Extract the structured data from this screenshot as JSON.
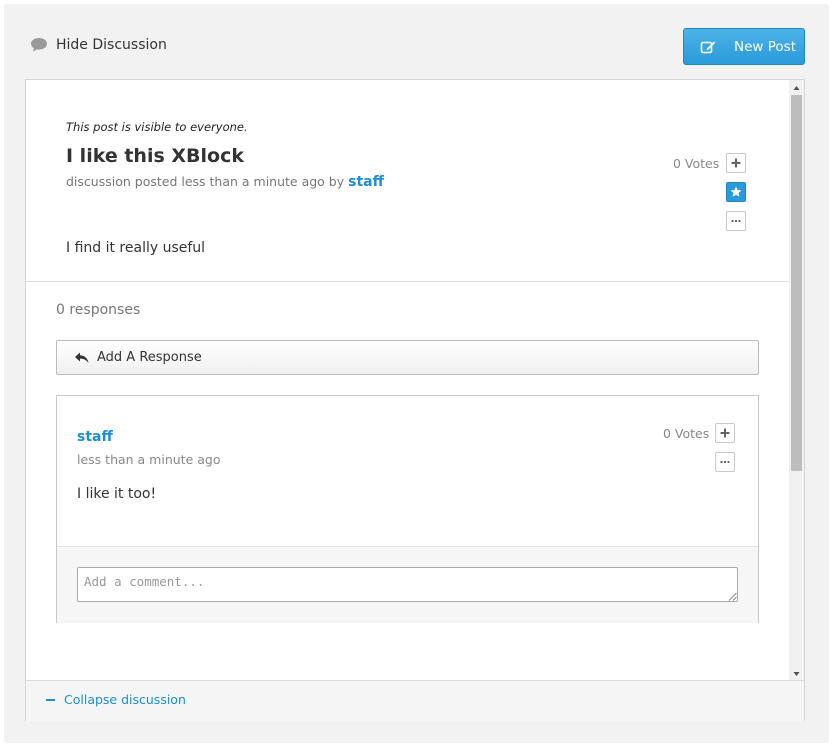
{
  "header": {
    "hide_discussion_label": "Hide Discussion",
    "new_post_label": "New Post",
    "icons": {
      "hide": "speech-bubble-icon",
      "new_post": "edit-icon"
    }
  },
  "thread": {
    "visibility_note": "This post is visible to everyone.",
    "title": "I like this XBlock",
    "meta_prefix": "discussion posted less than a minute ago by",
    "author": "staff",
    "votes": "0 Votes",
    "body": "I find it really useful",
    "icons": {
      "vote": "plus-icon",
      "follow": "star-icon",
      "more": "ellipsis-icon"
    }
  },
  "responses": {
    "count_label": "0 responses",
    "add_response_label": "Add A Response",
    "items": [
      {
        "author": "staff",
        "time": "less than a minute ago",
        "votes": "0 Votes",
        "body": "I like it too!",
        "comment_placeholder": "Add a comment..."
      }
    ]
  },
  "footer": {
    "collapse_label": "Collapse discussion"
  },
  "colors": {
    "accent": "#1c8ed3",
    "button_blue": "#2b9ad9",
    "muted_text": "#777777",
    "background": "#f2f2f2"
  }
}
